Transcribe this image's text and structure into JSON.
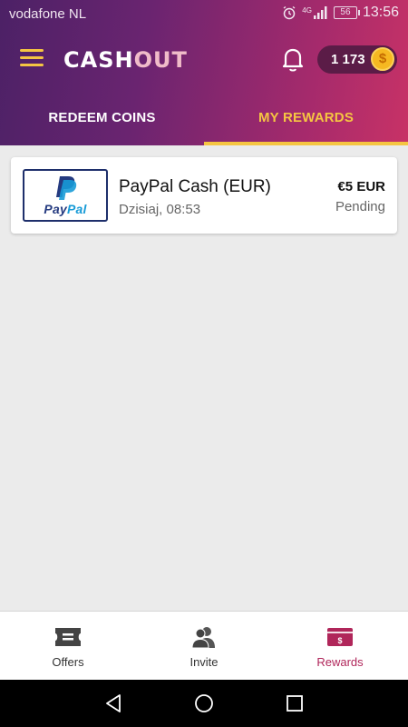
{
  "status_bar": {
    "carrier": "vodafone NL",
    "network": "4G",
    "battery": "56",
    "time": "13:56"
  },
  "app_bar": {
    "logo_part1": "CASH",
    "logo_part2": "OUT",
    "coin_balance": "1 173",
    "coin_symbol": "$"
  },
  "tabs": [
    {
      "label": "REDEEM COINS",
      "active": false
    },
    {
      "label": "MY REWARDS",
      "active": true
    }
  ],
  "rewards": [
    {
      "brand_part1": "Pay",
      "brand_part2": "Pal",
      "title": "PayPal Cash (EUR)",
      "date": "Dzisiaj, 08:53",
      "amount": "€5 EUR",
      "status": "Pending"
    }
  ],
  "bottom_nav": [
    {
      "label": "Offers",
      "icon": "ticket-icon",
      "active": false
    },
    {
      "label": "Invite",
      "icon": "people-icon",
      "active": false
    },
    {
      "label": "Rewards",
      "icon": "wallet-icon",
      "active": true,
      "icon_symbol": "$"
    }
  ],
  "colors": {
    "accent": "#f5c542",
    "header_start": "#4c2166",
    "header_end": "#c83266",
    "active_nav": "#b0265a"
  }
}
